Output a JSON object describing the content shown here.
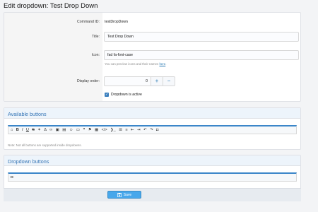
{
  "page": {
    "title": "Edit dropdown: Test Drop Down"
  },
  "form": {
    "command_id": {
      "label": "Command ID:",
      "value": "testDropDown"
    },
    "title": {
      "label": "Title:",
      "value": "Test Drop Down"
    },
    "icon": {
      "label": "Icon:",
      "value": "fad fa-font-case",
      "hint_text": "You can preview icons and their names",
      "hint_link": "here"
    },
    "display_order": {
      "label": "Display order:",
      "value": "0",
      "plus": "+",
      "minus": "−"
    },
    "active": {
      "label": "Dropdown is active",
      "checked": true
    }
  },
  "available": {
    "title": "Available buttons",
    "toolbar": [
      "⌂",
      "B",
      "I",
      "U",
      "S",
      "✶",
      "Δ",
      "∞",
      "▣",
      "▤",
      "☺",
      "▭",
      "❝",
      "⚑",
      "▦",
      "</>",
      "❯_",
      "☰",
      "≡",
      "⇤",
      "⇥",
      "↶",
      "↷",
      "◘"
    ],
    "note": "Note: Not all buttons are supported inside dropdowns."
  },
  "dropdown": {
    "title": "Dropdown buttons",
    "toolbar": [
      "◘"
    ]
  },
  "footer": {
    "save_label": "Save",
    "save_icon": "save-icon"
  }
}
